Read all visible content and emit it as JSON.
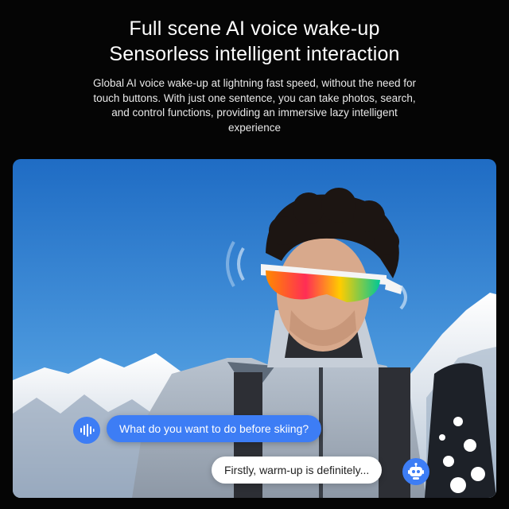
{
  "header": {
    "title_line1": "Full scene AI voice wake-up",
    "title_line2": "Sensorless intelligent interaction",
    "description": "Global AI voice wake-up at lightning fast speed, without the need for touch buttons. With just one sentence, you can take photos, search, and control functions, providing an immersive lazy intelligent experience"
  },
  "chat": {
    "user_message": "What do you want to do before skiing?",
    "assistant_reply": "Firstly, warm-up is definitely..."
  },
  "icons": {
    "user": "voice-waveform-icon",
    "assistant": "robot-icon"
  },
  "colors": {
    "background": "#050505",
    "accent": "#3d7df5",
    "sky": "#3a86d4"
  }
}
